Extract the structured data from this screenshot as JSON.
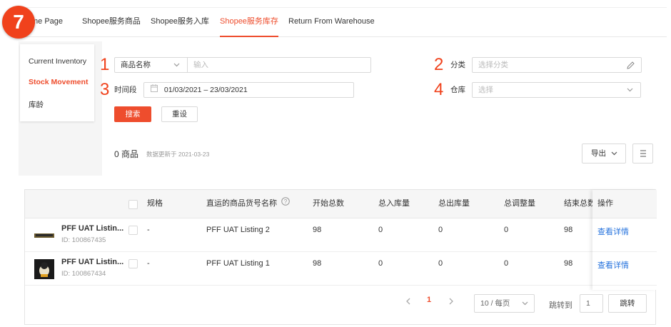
{
  "step_badge": "7",
  "tabs": [
    {
      "label": "me Page"
    },
    {
      "label": "Shopee服务商品"
    },
    {
      "label": "Shopee服务入库"
    },
    {
      "label": "Shopee服务库存"
    },
    {
      "label": "Return From Warehouse"
    }
  ],
  "sidebar": {
    "items": [
      {
        "label": "Current Inventory"
      },
      {
        "label": "Stock Movement"
      },
      {
        "label": "库龄"
      }
    ]
  },
  "filters": {
    "numbers": [
      "1",
      "2",
      "3",
      "4"
    ],
    "product_select": "商品名称",
    "product_input_placeholder": "输入",
    "category_label": "分类",
    "category_placeholder": "选择分类",
    "period_label": "时间段",
    "period_value": "01/03/2021 – 23/03/2021",
    "warehouse_label": "仓库",
    "warehouse_placeholder": "选择",
    "search_button": "搜索",
    "reset_button": "重设"
  },
  "summary": {
    "count_text": "0 商品",
    "updated_text": "数据更新于 2021-03-23",
    "export_button": "导出"
  },
  "table": {
    "headers": [
      "规格",
      "直运的商品货号名称",
      "开始总数",
      "总入库量",
      "总出库量",
      "总调整量",
      "结束总数",
      "操作"
    ],
    "rows": [
      {
        "name": "PFF UAT Listin...",
        "id": "ID: 100867435",
        "spec": "-",
        "sku_name": "PFF UAT Listing 2",
        "start": "98",
        "in": "0",
        "out": "0",
        "adjust": "0",
        "end": "98",
        "action": "查看详情"
      },
      {
        "name": "PFF UAT Listin...",
        "id": "ID: 100867434",
        "spec": "-",
        "sku_name": "PFF UAT Listing 1",
        "start": "98",
        "in": "0",
        "out": "0",
        "adjust": "0",
        "end": "98",
        "action": "查看详情"
      }
    ]
  },
  "pagination": {
    "current_page": "1",
    "page_size": "10 / 每页",
    "jump_label": "跳转到",
    "jump_value": "1",
    "jump_button": "跳转"
  },
  "colors": {
    "accent": "#ee4d2d",
    "link": "#2673dd",
    "badge": "#f0421c"
  }
}
